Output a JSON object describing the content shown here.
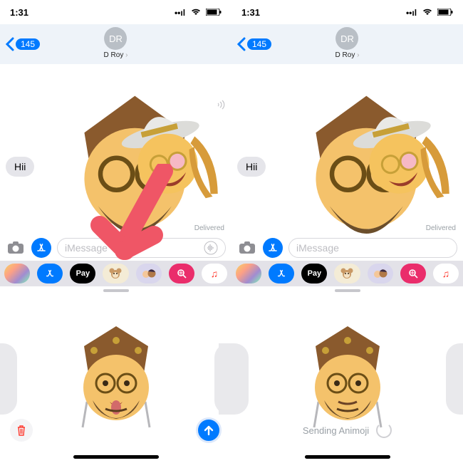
{
  "status": {
    "time": "1:31",
    "signal": "▪▫",
    "wifi": "᯾",
    "battery": "▉"
  },
  "header": {
    "back_count": "145",
    "contact_initials": "DR",
    "contact_name": "D Roy"
  },
  "conversation": {
    "message_text": "Hii",
    "delivered_label": "Delivered"
  },
  "input": {
    "placeholder": "iMessage"
  },
  "app_strip": {
    "apple_pay_label": "Pay",
    "music_glyph": "♫"
  },
  "left_drawer": {},
  "right_drawer": {
    "sending_label": "Sending Animoji"
  }
}
